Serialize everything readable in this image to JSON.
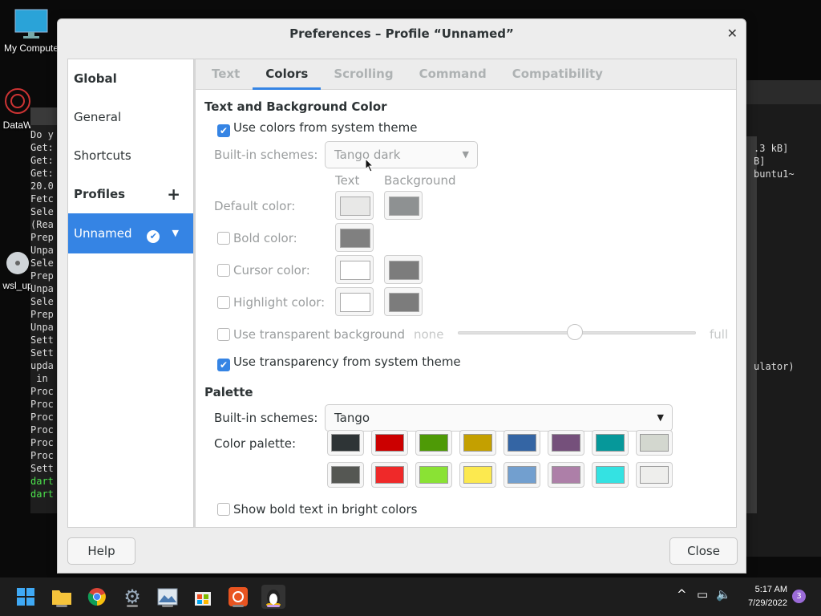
{
  "desktop": {
    "icons": [
      {
        "label": "My Compute",
        "icon": "monitor-icon"
      },
      {
        "label": "DataW",
        "icon": "app-icon"
      },
      {
        "label": "wsl_up",
        "icon": "disc-icon"
      }
    ],
    "terminal_left_lines": [
      "Do y",
      "Get:",
      "Get:",
      "Get:",
      "20.0",
      "Fetc",
      "Sele",
      "(Rea",
      "Prep",
      "Unpa",
      "Sele",
      "Prep",
      "Unpa",
      "Sele",
      "Prep",
      "Unpa",
      "Sett",
      "Sett",
      "upda",
      " in",
      "Proc",
      "Proc",
      "Proc",
      "Proc",
      "Proc",
      "Proc",
      "Sett",
      "dart",
      "dart"
    ],
    "terminal_right_lines": [
      ".3 kB]",
      "B]",
      "buntu1~",
      "ulator)"
    ]
  },
  "dialog": {
    "title": "Preferences – Profile “Unnamed”",
    "close_glyph": "✕",
    "sidebar": {
      "global": "Global",
      "general": "General",
      "shortcuts": "Shortcuts",
      "profiles": "Profiles",
      "add_glyph": "+",
      "profile_name": "Unnamed",
      "check_glyph": "✔",
      "caret_glyph": "▼"
    },
    "tabs": [
      "Text",
      "Colors",
      "Scrolling",
      "Command",
      "Compatibility"
    ],
    "active_tab": "Colors",
    "text_bg": {
      "section_title": "Text and Background Color",
      "use_system_colors": "Use colors from system theme",
      "builtin_label": "Built-in schemes:",
      "builtin_value": "Tango dark",
      "col_text": "Text",
      "col_background": "Background",
      "default_color": "Default color:",
      "bold_color": "Bold color:",
      "cursor_color": "Cursor color:",
      "highlight_color": "Highlight color:",
      "use_transparent_bg": "Use transparent background",
      "none": "none",
      "full": "full",
      "use_transparency_system": "Use transparency from system theme"
    },
    "swatch_colors": {
      "default_text": "#e8e8e7",
      "default_bg": "#8e9192",
      "bold_text": "#808080",
      "cursor_text": "#ffffff",
      "cursor_bg": "#7c7c7c",
      "highlight_text": "#ffffff",
      "highlight_bg": "#7c7c7c"
    },
    "palette": {
      "section_title": "Palette",
      "builtin_label": "Built-in schemes:",
      "builtin_value": "Tango",
      "color_palette_label": "Color palette:",
      "row1": [
        "#2e3436",
        "#cc0000",
        "#4e9a06",
        "#c4a000",
        "#3465a4",
        "#75507b",
        "#06989a",
        "#d3d7cf"
      ],
      "row2": [
        "#555753",
        "#ef2929",
        "#8ae234",
        "#fce94f",
        "#729fcf",
        "#ad7fa8",
        "#34e2e2",
        "#eeeeec"
      ],
      "bold_bright": "Show bold text in bright colors"
    },
    "buttons": {
      "help": "Help",
      "close": "Close"
    }
  },
  "taskbar": {
    "time": "5:17 AM",
    "date": "7/29/2022",
    "notifications": "3",
    "tray_chevron": "^"
  }
}
